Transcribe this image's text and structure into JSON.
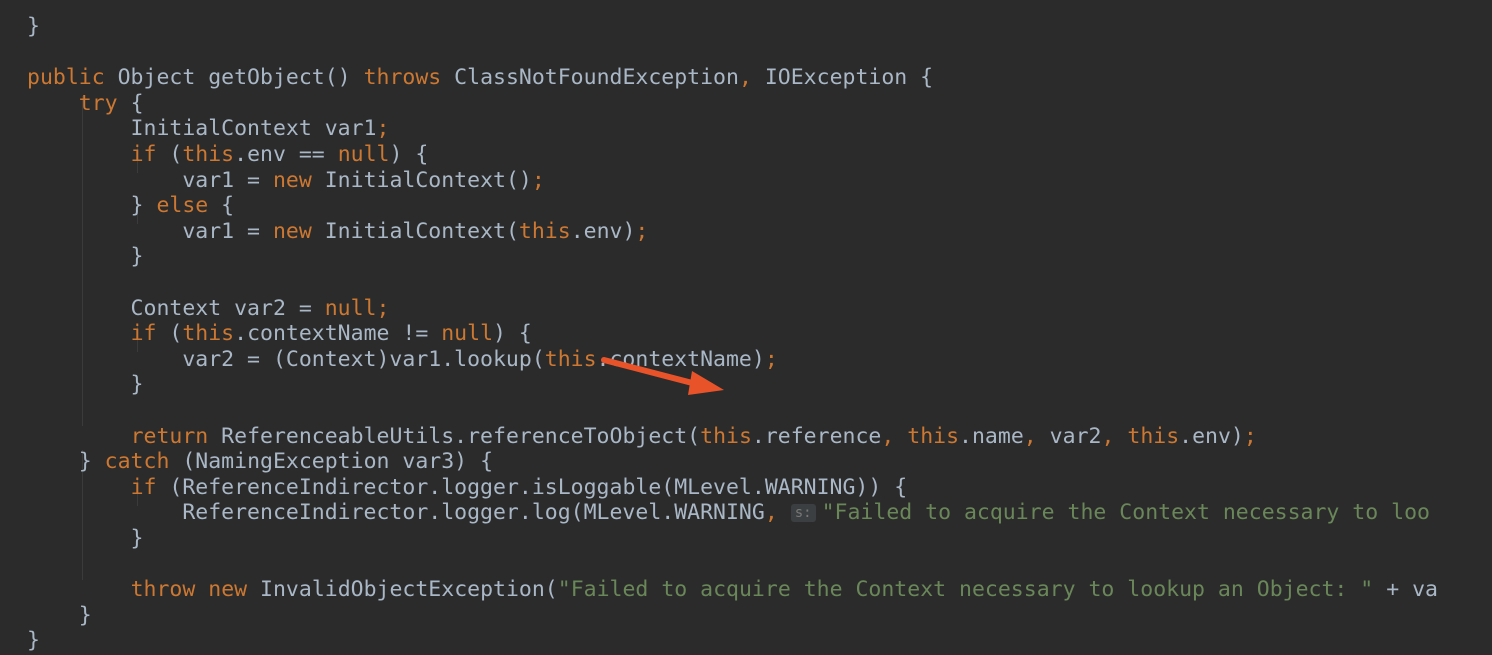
{
  "colors": {
    "background": "#2b2b2b",
    "keyword": "#cc7832",
    "text": "#a9b7c6",
    "string": "#6a8759",
    "hint": "#787878",
    "hint_background": "#3c3f41",
    "arrow": "#e8532a",
    "indent_guide": "#3b3b3b"
  },
  "arrow": {
    "icon": "red-arrow-icon",
    "points_to": "this.reference"
  },
  "code": {
    "lines": [
      {
        "tokens": [
          {
            "t": "}",
            "k": "p"
          }
        ]
      },
      {
        "tokens": []
      },
      {
        "tokens": [
          {
            "t": "public",
            "k": "kw"
          },
          {
            "t": " Object getObject() ",
            "k": "p"
          },
          {
            "t": "throws",
            "k": "kw"
          },
          {
            "t": " ClassNotFoundException",
            "k": "p"
          },
          {
            "t": ",",
            "k": "kw"
          },
          {
            "t": " IOException {",
            "k": "p"
          }
        ]
      },
      {
        "tokens": [
          {
            "t": "    ",
            "k": "p"
          },
          {
            "t": "try",
            "k": "kw"
          },
          {
            "t": " {",
            "k": "p"
          }
        ]
      },
      {
        "tokens": [
          {
            "t": "        InitialContext var1",
            "k": "p"
          },
          {
            "t": ";",
            "k": "kw"
          }
        ]
      },
      {
        "tokens": [
          {
            "t": "        ",
            "k": "p"
          },
          {
            "t": "if",
            "k": "kw"
          },
          {
            "t": " (",
            "k": "p"
          },
          {
            "t": "this",
            "k": "kw"
          },
          {
            "t": ".env == ",
            "k": "p"
          },
          {
            "t": "null",
            "k": "kw"
          },
          {
            "t": ") {",
            "k": "p"
          }
        ]
      },
      {
        "tokens": [
          {
            "t": "            var1 = ",
            "k": "p"
          },
          {
            "t": "new",
            "k": "kw"
          },
          {
            "t": " InitialContext()",
            "k": "p"
          },
          {
            "t": ";",
            "k": "kw"
          }
        ]
      },
      {
        "tokens": [
          {
            "t": "        } ",
            "k": "p"
          },
          {
            "t": "else",
            "k": "kw"
          },
          {
            "t": " {",
            "k": "p"
          }
        ]
      },
      {
        "tokens": [
          {
            "t": "            var1 = ",
            "k": "p"
          },
          {
            "t": "new",
            "k": "kw"
          },
          {
            "t": " InitialContext(",
            "k": "p"
          },
          {
            "t": "this",
            "k": "kw"
          },
          {
            "t": ".env)",
            "k": "p"
          },
          {
            "t": ";",
            "k": "kw"
          }
        ]
      },
      {
        "tokens": [
          {
            "t": "        }",
            "k": "p"
          }
        ]
      },
      {
        "tokens": []
      },
      {
        "tokens": [
          {
            "t": "        Context var2 = ",
            "k": "p"
          },
          {
            "t": "null",
            "k": "kw"
          },
          {
            "t": ";",
            "k": "kw"
          }
        ]
      },
      {
        "tokens": [
          {
            "t": "        ",
            "k": "p"
          },
          {
            "t": "if",
            "k": "kw"
          },
          {
            "t": " (",
            "k": "p"
          },
          {
            "t": "this",
            "k": "kw"
          },
          {
            "t": ".contextName != ",
            "k": "p"
          },
          {
            "t": "null",
            "k": "kw"
          },
          {
            "t": ") {",
            "k": "p"
          }
        ]
      },
      {
        "tokens": [
          {
            "t": "            var2 = (Context)var1.lookup(",
            "k": "p"
          },
          {
            "t": "this",
            "k": "kw"
          },
          {
            "t": ".contextName)",
            "k": "p"
          },
          {
            "t": ";",
            "k": "kw"
          }
        ]
      },
      {
        "tokens": [
          {
            "t": "        }",
            "k": "p"
          }
        ]
      },
      {
        "tokens": []
      },
      {
        "tokens": [
          {
            "t": "        ",
            "k": "p"
          },
          {
            "t": "return",
            "k": "kw"
          },
          {
            "t": " ReferenceableUtils.referenceToObject(",
            "k": "p"
          },
          {
            "t": "this",
            "k": "kw"
          },
          {
            "t": ".reference",
            "k": "p"
          },
          {
            "t": ",",
            "k": "kw"
          },
          {
            "t": " ",
            "k": "p"
          },
          {
            "t": "this",
            "k": "kw"
          },
          {
            "t": ".name",
            "k": "p"
          },
          {
            "t": ",",
            "k": "kw"
          },
          {
            "t": " var2",
            "k": "p"
          },
          {
            "t": ",",
            "k": "kw"
          },
          {
            "t": " ",
            "k": "p"
          },
          {
            "t": "this",
            "k": "kw"
          },
          {
            "t": ".env)",
            "k": "p"
          },
          {
            "t": ";",
            "k": "kw"
          }
        ]
      },
      {
        "tokens": [
          {
            "t": "    } ",
            "k": "p"
          },
          {
            "t": "catch",
            "k": "kw"
          },
          {
            "t": " (NamingException var3) {",
            "k": "p"
          }
        ]
      },
      {
        "tokens": [
          {
            "t": "        ",
            "k": "p"
          },
          {
            "t": "if",
            "k": "kw"
          },
          {
            "t": " (ReferenceIndirector.logger.isLoggable(MLevel.WARNING)) {",
            "k": "p"
          }
        ]
      },
      {
        "tokens": [
          {
            "t": "            ReferenceIndirector.logger.log(MLevel.WARNING",
            "k": "p"
          },
          {
            "t": ",",
            "k": "kw"
          },
          {
            "t": " ",
            "k": "p"
          },
          {
            "t": "s:",
            "k": "hint"
          },
          {
            "t": "\"Failed to acquire the Context necessary to loo",
            "k": "str"
          }
        ]
      },
      {
        "tokens": [
          {
            "t": "        }",
            "k": "p"
          }
        ]
      },
      {
        "tokens": []
      },
      {
        "tokens": [
          {
            "t": "        ",
            "k": "p"
          },
          {
            "t": "throw",
            "k": "kw"
          },
          {
            "t": " ",
            "k": "p"
          },
          {
            "t": "new",
            "k": "kw"
          },
          {
            "t": " InvalidObjectException(",
            "k": "p"
          },
          {
            "t": "\"Failed to acquire the Context necessary to lookup an Object: \"",
            "k": "str"
          },
          {
            "t": " + va",
            "k": "p"
          }
        ]
      },
      {
        "tokens": [
          {
            "t": "    }",
            "k": "p"
          }
        ]
      },
      {
        "tokens": [
          {
            "t": "}",
            "k": "p"
          }
        ]
      }
    ]
  }
}
